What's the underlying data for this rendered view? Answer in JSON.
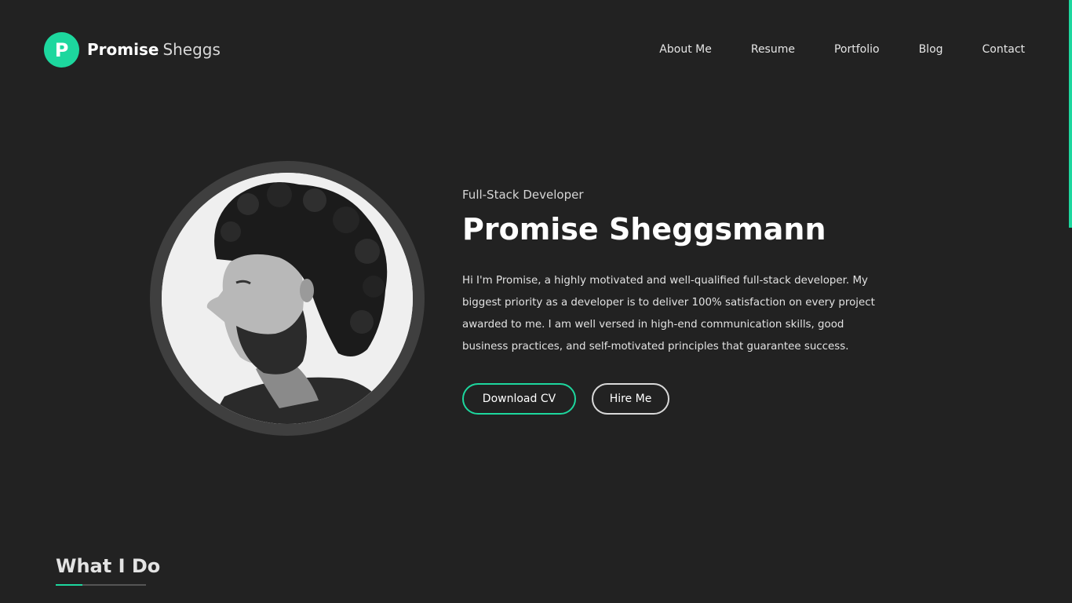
{
  "brand": {
    "badge_letter": "P",
    "first_name": "Promise",
    "last_name": "Sheggs"
  },
  "nav": {
    "items": [
      {
        "label": "About Me"
      },
      {
        "label": "Resume"
      },
      {
        "label": "Portfolio"
      },
      {
        "label": "Blog"
      },
      {
        "label": "Contact"
      }
    ]
  },
  "hero": {
    "role": "Full-Stack Developer",
    "name": "Promise Sheggsmann",
    "bio": "Hi I'm Promise, a highly motivated and well-qualified full-stack developer. My biggest priority as a developer is to deliver 100% satisfaction on every project awarded to me. I am well versed in high-end communication skills, good business practices, and self-motivated principles that guarantee success.",
    "buttons": {
      "download": "Download CV",
      "hire": "Hire Me"
    }
  },
  "section": {
    "title": "What I Do"
  },
  "colors": {
    "accent": "#1dd79e",
    "background": "#222222"
  },
  "icons": {
    "avatar": "portrait-photo"
  }
}
